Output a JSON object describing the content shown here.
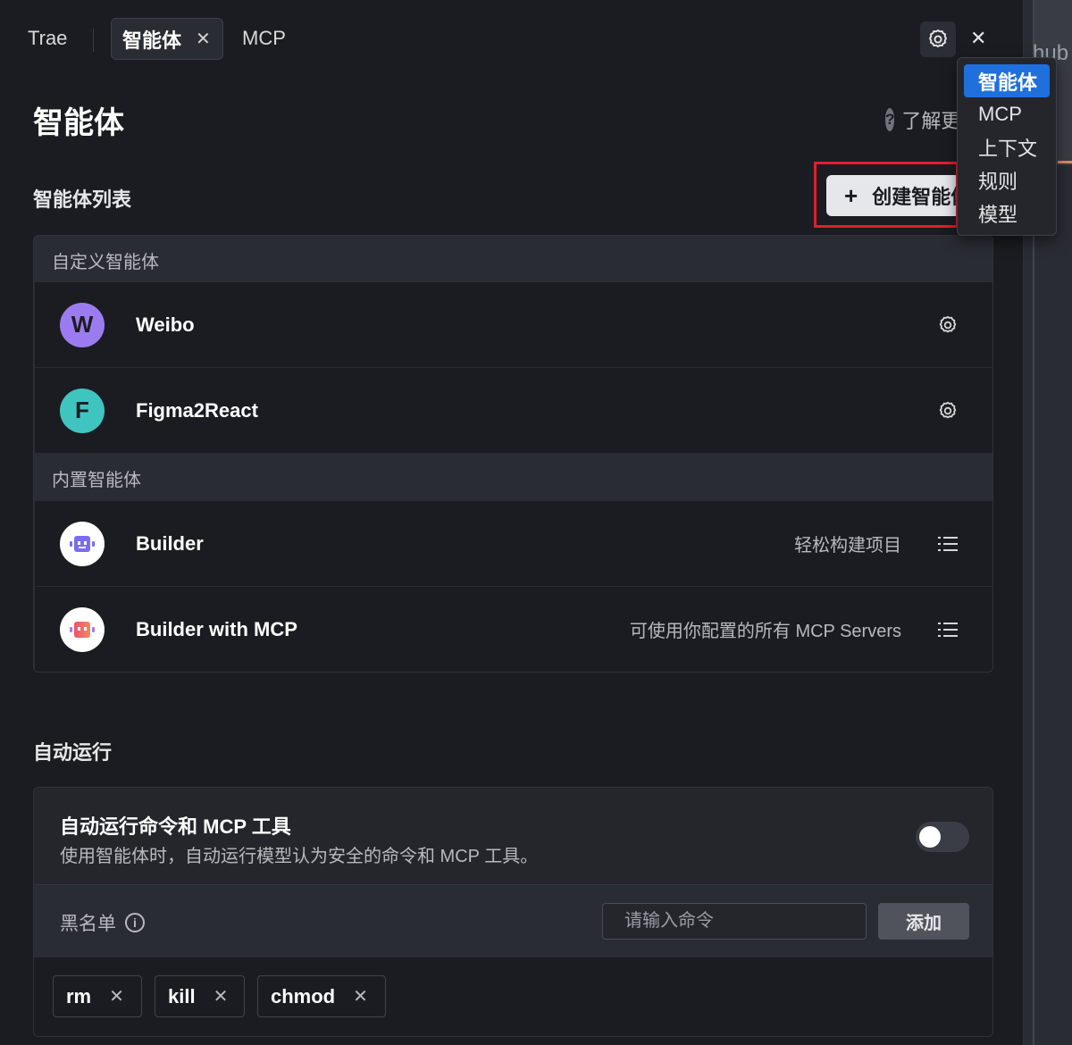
{
  "tabs": {
    "trae": "Trae",
    "active": "智能体",
    "active_close": "✕",
    "mcp": "MCP"
  },
  "header": {
    "close": "✕"
  },
  "dropdown": {
    "items": [
      "智能体",
      "MCP",
      "上下文",
      "规则",
      "模型"
    ]
  },
  "background_text": "hub",
  "page": {
    "title": "智能体",
    "learn": "了解更多",
    "learn_icon": "?"
  },
  "agents": {
    "section_title": "智能体列表",
    "create_button": "创建智能体",
    "custom_label": "自定义智能体",
    "builtin_label": "内置智能体",
    "custom": [
      {
        "avatar": "W",
        "name": "Weibo",
        "color": "#9b7cf0"
      },
      {
        "avatar": "F",
        "name": "Figma2React",
        "color": "#40c4c0"
      }
    ],
    "builtin": [
      {
        "name": "Builder",
        "desc": "轻松构建项目"
      },
      {
        "name": "Builder with MCP",
        "desc": "可使用你配置的所有 MCP Servers"
      }
    ]
  },
  "autorun": {
    "section_title": "自动运行",
    "title": "自动运行命令和 MCP 工具",
    "subtitle": "使用智能体时，自动运行模型认为安全的命令和 MCP 工具。",
    "toggle_on": false,
    "blacklist_label": "黑名单",
    "info_icon": "i",
    "input_placeholder": "请输入命令",
    "add_button": "添加",
    "chips": [
      "rm",
      "kill",
      "chmod"
    ],
    "chip_close": "✕"
  },
  "colors": {
    "accent": "#1f6fdc",
    "highlight_box": "#e01e2e"
  }
}
